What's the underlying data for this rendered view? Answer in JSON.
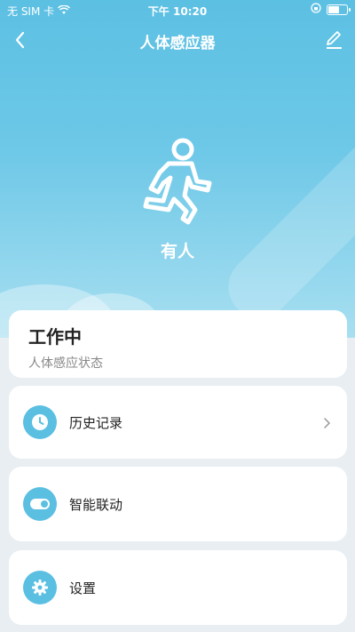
{
  "status_bar": {
    "carrier": "无 SIM 卡",
    "time": "下午 10:20"
  },
  "nav": {
    "title": "人体感应器",
    "back_icon": "chevron-left-icon",
    "edit_icon": "pencil-icon"
  },
  "hero": {
    "icon": "walking-person-icon",
    "state": "有人"
  },
  "status_card": {
    "title": "工作中",
    "subtitle": "人体感应状态"
  },
  "menu": [
    {
      "label": "历史记录",
      "icon": "clock-icon"
    },
    {
      "label": "智能联动",
      "icon": "toggle-icon"
    },
    {
      "label": "设置",
      "icon": "gear-icon"
    }
  ],
  "colors": {
    "accent": "#5bbfe2",
    "hero_top": "#5cc0e3",
    "background": "#e9eef2"
  }
}
